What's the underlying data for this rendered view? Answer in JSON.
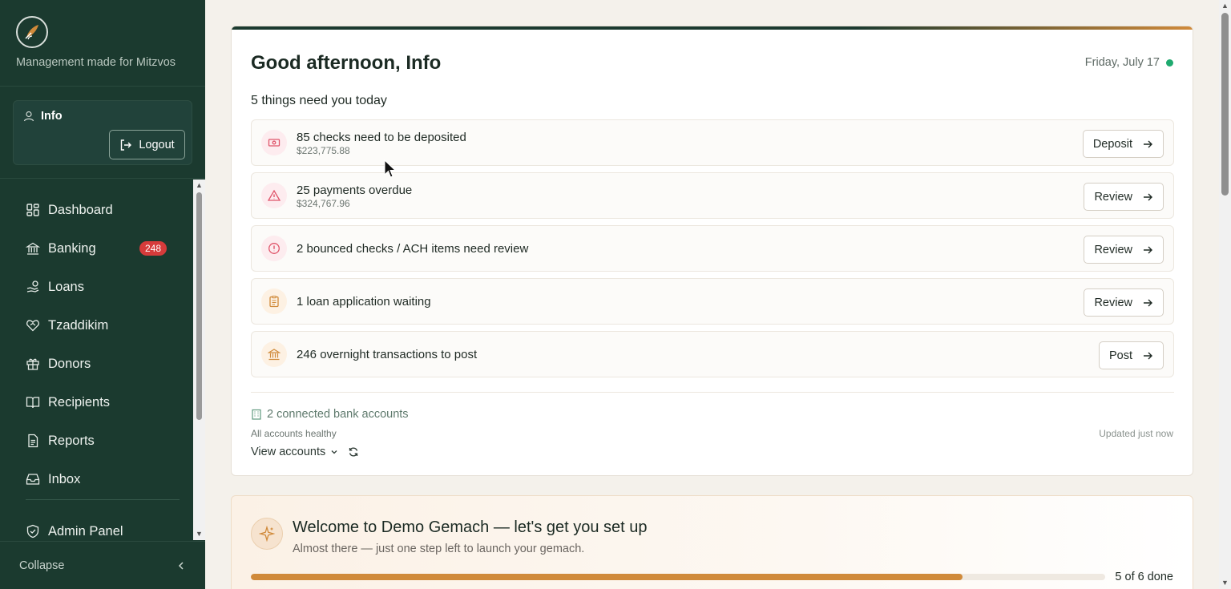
{
  "sidebar": {
    "tagline": "Management made for Mitzvos",
    "user": {
      "name": "Info",
      "logout_label": "Logout"
    },
    "items": [
      {
        "label": "Dashboard",
        "icon": "dashboard-icon"
      },
      {
        "label": "Banking",
        "icon": "bank-icon",
        "badge": "248"
      },
      {
        "label": "Loans",
        "icon": "hand-coins-icon"
      },
      {
        "label": "Tzaddikim",
        "icon": "heart-handshake-icon"
      },
      {
        "label": "Donors",
        "icon": "gift-icon"
      },
      {
        "label": "Recipients",
        "icon": "book-open-icon"
      },
      {
        "label": "Reports",
        "icon": "file-text-icon"
      },
      {
        "label": "Inbox",
        "icon": "inbox-icon"
      },
      {
        "label": "Admin Panel",
        "icon": "shield-check-icon"
      }
    ],
    "collapse_label": "Collapse"
  },
  "header": {
    "greeting": "Good afternoon, Info",
    "date": "Friday, July 17",
    "tasks_count": "5 things need you today"
  },
  "tasks": [
    {
      "title": "85 checks need to be deposited",
      "amount": "$223,775.88",
      "action": "Deposit",
      "icon": "banknote-icon",
      "color": "#e0566b"
    },
    {
      "title": "25 payments overdue",
      "amount": "$324,767.96",
      "action": "Review",
      "icon": "alert-triangle-icon",
      "color": "#e0566b"
    },
    {
      "title": "2 bounced checks / ACH items need review",
      "action": "Review",
      "icon": "alert-circle-icon",
      "color": "#e0566b"
    },
    {
      "title": "1 loan application waiting",
      "action": "Review",
      "icon": "clipboard-icon",
      "color": "#d08a3a"
    },
    {
      "title": "246 overnight transactions to post",
      "action": "Post",
      "icon": "bank-icon",
      "color": "#d08a3a"
    }
  ],
  "accounts": {
    "connected": "2 connected bank accounts",
    "status": "All accounts healthy",
    "updated": "Updated just now",
    "view_label": "View accounts"
  },
  "welcome": {
    "title": "Welcome to Demo Gemach — let's get you set up",
    "subtitle": "Almost there — just one step left to launch your gemach.",
    "progress_label": "5 of 6 done",
    "progress_fraction": 0.8333
  },
  "colors": {
    "sidebar_bg": "#1b3a2f",
    "accent": "#d08a3a",
    "alert": "#e0566b",
    "online": "#1faa6f"
  }
}
